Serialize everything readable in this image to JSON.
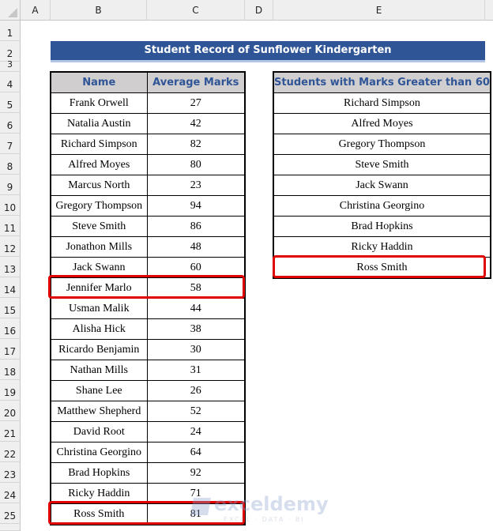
{
  "columns": [
    "A",
    "B",
    "C",
    "D",
    "E"
  ],
  "rows": [
    "1",
    "2",
    "3",
    "4",
    "5",
    "6",
    "7",
    "8",
    "9",
    "10",
    "11",
    "12",
    "13",
    "14",
    "15",
    "16",
    "17",
    "18",
    "19",
    "20",
    "21",
    "22",
    "23",
    "24",
    "25"
  ],
  "title": "Student Record of Sunflower Kindergarten",
  "main_table": {
    "headers": [
      "Name",
      "Average Marks"
    ],
    "rows": [
      {
        "name": "Frank Orwell",
        "marks": "27"
      },
      {
        "name": "Natalia Austin",
        "marks": "42"
      },
      {
        "name": "Richard Simpson",
        "marks": "82"
      },
      {
        "name": "Alfred Moyes",
        "marks": "80"
      },
      {
        "name": "Marcus North",
        "marks": "23"
      },
      {
        "name": "Gregory Thompson",
        "marks": "94"
      },
      {
        "name": "Steve Smith",
        "marks": "86"
      },
      {
        "name": "Jonathon Mills",
        "marks": "48"
      },
      {
        "name": "Jack Swann",
        "marks": "60"
      },
      {
        "name": "Jennifer Marlo",
        "marks": "58"
      },
      {
        "name": "Usman Malik",
        "marks": "44"
      },
      {
        "name": "Alisha Hick",
        "marks": "38"
      },
      {
        "name": "Ricardo Benjamin",
        "marks": "30"
      },
      {
        "name": "Nathan Mills",
        "marks": "31"
      },
      {
        "name": "Shane Lee",
        "marks": "26"
      },
      {
        "name": "Matthew Shepherd",
        "marks": "52"
      },
      {
        "name": "David Root",
        "marks": "24"
      },
      {
        "name": "Christina Georgino",
        "marks": "64"
      },
      {
        "name": "Brad Hopkins",
        "marks": "92"
      },
      {
        "name": "Ricky Haddin",
        "marks": "71"
      },
      {
        "name": "Ross Smith",
        "marks": "81"
      }
    ]
  },
  "result_table": {
    "header": "Students with Marks Greater than 60",
    "rows": [
      "Richard Simpson",
      "Alfred Moyes",
      "Gregory Thompson",
      "Steve Smith",
      "Jack Swann",
      "Christina Georgino",
      "Brad Hopkins",
      "Ricky Haddin",
      "Ross Smith"
    ]
  },
  "highlights": [
    "Jennifer Marlo",
    "Ross Smith (main table)",
    "Ross Smith (result table)"
  ],
  "watermark": {
    "brand": "exceldemy",
    "tagline": "EXCEL · DATA · BI"
  },
  "colors": {
    "title_bg": "#2f5597",
    "header_bg": "#d0cece",
    "header_text": "#2f5597",
    "highlight": "#e00000"
  }
}
